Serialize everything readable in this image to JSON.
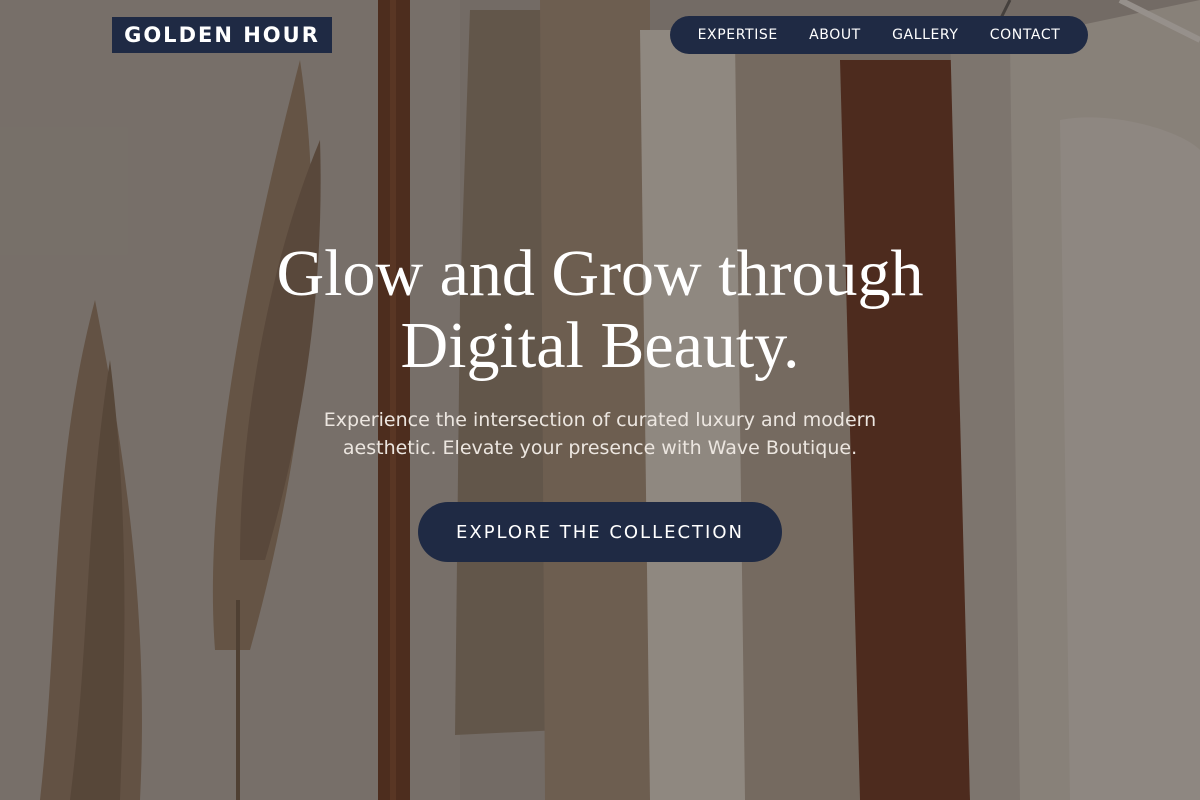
{
  "brand": {
    "name": "GOLDEN HOUR"
  },
  "nav": {
    "items": [
      {
        "label": "EXPERTISE"
      },
      {
        "label": "ABOUT"
      },
      {
        "label": "GALLERY"
      },
      {
        "label": "CONTACT"
      }
    ]
  },
  "hero": {
    "headline_line1": "Glow and Grow through",
    "headline_line2": "Digital Beauty.",
    "subtext": "Experience the intersection of curated luxury and modern aesthetic. Elevate your presence with Wave Boutique.",
    "cta_label": "EXPLORE THE COLLECTION",
    "background_image": "clothing-rack-with-pampas-grass-photo"
  },
  "colors": {
    "navy": "#1f2a44",
    "text_light": "#ffffff",
    "subtext": "#ece6e0"
  }
}
